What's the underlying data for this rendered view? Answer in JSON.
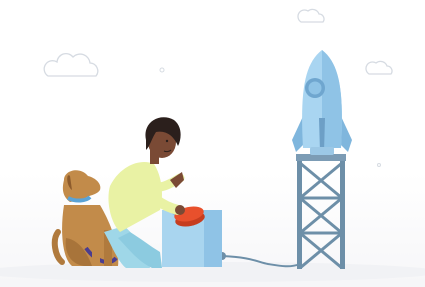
{
  "scene": {
    "subject": "person-with-dog-pressing-launch-button",
    "icons": [
      "cloud-icon",
      "rocket-icon",
      "launch-tower-icon",
      "dog-icon",
      "person-icon",
      "red-button-icon"
    ],
    "colors": {
      "rocket": "#9fd0ee",
      "rocket_shadow": "#7fb6dd",
      "tower": "#6d8fa8",
      "box": "#a9d5ef",
      "button": "#e8502c",
      "shirt": "#e9f2a4",
      "pants": "#9fd7e8",
      "dog": "#c28b4a",
      "skin": "#7a4a35",
      "hair": "#2b1f1c",
      "cloud_outline": "#d9dde3"
    }
  }
}
